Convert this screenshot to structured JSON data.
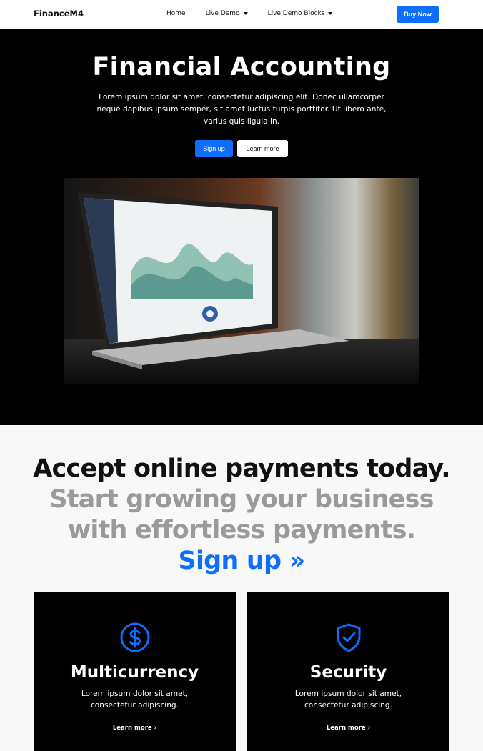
{
  "header": {
    "brand": "FinanceM4",
    "links": [
      "Home",
      "Live Demo",
      "Live Demo Blocks"
    ],
    "buy_label": "Buy Now"
  },
  "hero": {
    "title": "Financial Accounting",
    "text": "Lorem ipsum dolor sit amet, consectetur adipiscing elit. Donec ullamcorper neque dapibus ipsum semper, sit amet luctus turpis porttitor. Ut libero ante, varius quis ligula in.",
    "signup_label": "Sign up",
    "learn_label": "Learn more"
  },
  "cta": {
    "heading": "Accept online payments today.",
    "sub": "Start growing your business with effortless payments.",
    "link": "Sign up »"
  },
  "cards": [
    {
      "title": "Multicurrency",
      "text": "Lorem ipsum dolor sit amet, consectetur adipiscing.",
      "more": "Learn more ›",
      "icon": "dollar-circle-icon"
    },
    {
      "title": "Security",
      "text": "Lorem ipsum dolor sit amet, consectetur adipiscing.",
      "more": "Learn more ›",
      "icon": "shield-check-icon"
    }
  ],
  "colors": {
    "accent": "#0d6efd",
    "hero_bg": "#000000",
    "muted": "#9a9a9a"
  }
}
